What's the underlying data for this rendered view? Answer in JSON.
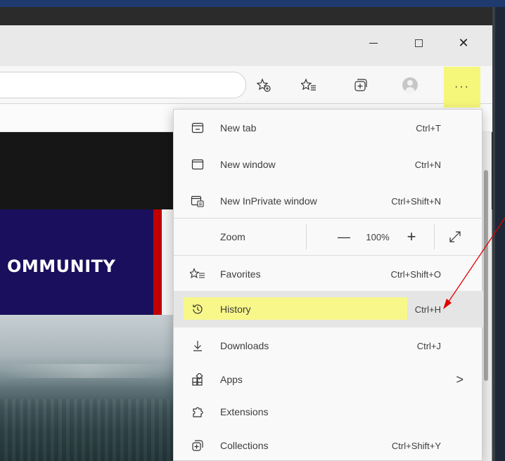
{
  "window": {
    "min_glyph": "–",
    "max_glyph": "☐",
    "close_glyph": "✕"
  },
  "toolbar": {
    "more_label": "···"
  },
  "page": {
    "banner_text": "OMMUNITY"
  },
  "menu": {
    "items": [
      {
        "label": "New tab",
        "shortcut": "Ctrl+T",
        "icon": "new-tab-icon"
      },
      {
        "label": "New window",
        "shortcut": "Ctrl+N",
        "icon": "new-window-icon"
      },
      {
        "label": "New InPrivate window",
        "shortcut": "Ctrl+Shift+N",
        "icon": "inprivate-icon"
      },
      {
        "label": "Favorites",
        "shortcut": "Ctrl+Shift+O",
        "icon": "favorites-icon"
      },
      {
        "label": "History",
        "shortcut": "Ctrl+H",
        "icon": "history-icon"
      },
      {
        "label": "Downloads",
        "shortcut": "Ctrl+J",
        "icon": "download-icon"
      },
      {
        "label": "Apps",
        "shortcut": "",
        "icon": "apps-icon"
      },
      {
        "label": "Extensions",
        "shortcut": "",
        "icon": "extensions-icon"
      },
      {
        "label": "Collections",
        "shortcut": "Ctrl+Shift+Y",
        "icon": "collections-icon"
      }
    ],
    "zoom": {
      "label": "Zoom",
      "value": "100%",
      "minus": "—",
      "plus": "+"
    }
  },
  "colors": {
    "highlight": "#f5f77a",
    "annotation": "#e00000",
    "banner": "#1a0f5c"
  }
}
